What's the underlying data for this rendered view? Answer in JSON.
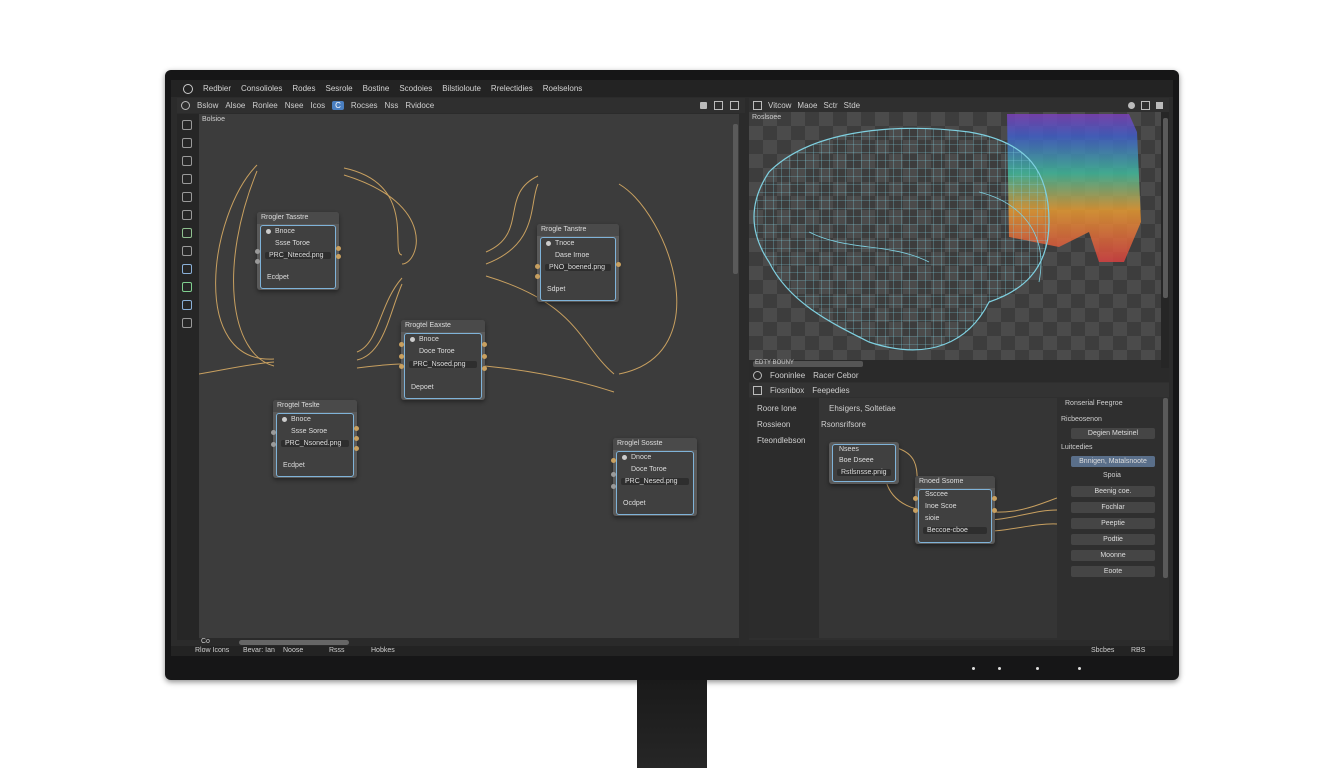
{
  "menubar": {
    "app_label": "Redbier",
    "items": [
      "Consolioles",
      "Rodes",
      "Sesrole",
      "Bostine",
      "Scodoies",
      "Bilstioloute",
      "Rrelectidies",
      "Roelselons"
    ]
  },
  "toolbar": {
    "items": [
      "Bslow",
      "Alsoe",
      "Ronlee",
      "Nsee",
      "Icos",
      "Rocses",
      "Nss",
      "Rvidoce"
    ],
    "selected_label": "C"
  },
  "node_editor": {
    "canvas_label": "Bolsioe",
    "nodes": [
      {
        "title": "Rrogler Tasstre",
        "row1": "Bnoce",
        "row2": "Ssse Toroe",
        "field": "PRC_Nteced.png",
        "footer": "Ecdpet"
      },
      {
        "title": "Rrogle Tanstre",
        "row1": "Tnoce",
        "row2": "Dase Irnoe",
        "field": "PNO_boened.png",
        "footer": "Sdpet"
      },
      {
        "title": "Rrogtel Eaxste",
        "row1": "Bnoce",
        "row2": "Doce Toroe",
        "field": "PRC_Nsoed.png",
        "footer": "Depoet"
      },
      {
        "title": "Rrogtel Teslte",
        "row1": "Bnoce",
        "row2": "Ssse Soroe",
        "field": "PRC_Nsoned.png",
        "footer": "Ecdpet"
      },
      {
        "title": "Rroglel Sosste",
        "row1": "Dnoce",
        "row2": "Doce Toroe",
        "field": "PRC_Nesed.png",
        "footer": "Ocdpet"
      }
    ],
    "scroll_label": "Co"
  },
  "viewport": {
    "header_items": [
      "Vitcow",
      "Maoe",
      "Sctr",
      "Stde"
    ],
    "canvas_label": "Roslsoee",
    "status_label": "EDTY BOUNY"
  },
  "texture_editor": {
    "header_left": "Fooninlee",
    "header_right": "Racer Cebor",
    "bar_left": "Fiosnibox",
    "bar_right": "Feepedies",
    "sidebar": [
      "Roore Ione",
      "Rossieon",
      "Fteondlebson"
    ],
    "main_title": "Ehsigers, Soltetiae",
    "main_subtitle": "Rsonsrifsore",
    "small_node": {
      "row1": "Nsees",
      "row2": "Boe Dseee",
      "field": "Rstlsnsse.pnig"
    },
    "big_node": {
      "title": "Rnoed Ssome",
      "row1": "Ssccee",
      "row2": "Inoe Scoe",
      "row3": "sioie",
      "row4": "Beccoe-cboe"
    },
    "right_panel": {
      "header": "Ronserial Feegroe",
      "section1": "Ricbeosenon",
      "field1": "Degien Metsinel",
      "section2": "Luitcedies",
      "selected": "Bnnigen, Matalsnoote",
      "label": "Spoia",
      "buttons": [
        "Beenig coe.",
        "Fochlar",
        "Peeptie",
        "Podtie",
        "Moonne",
        "Eoote"
      ]
    }
  },
  "status_bar": {
    "left_items": [
      "Rlow Icons",
      "Bevar: Ian",
      "Noose",
      "Rsss",
      "Hobkes"
    ],
    "right_items": [
      "Sbcbes",
      "RBS"
    ]
  },
  "colors": {
    "accent": "#4a7fc1",
    "node_border": "#7fb3d9",
    "wire": "#c8a060",
    "wireframe": "#7fd0e0"
  }
}
